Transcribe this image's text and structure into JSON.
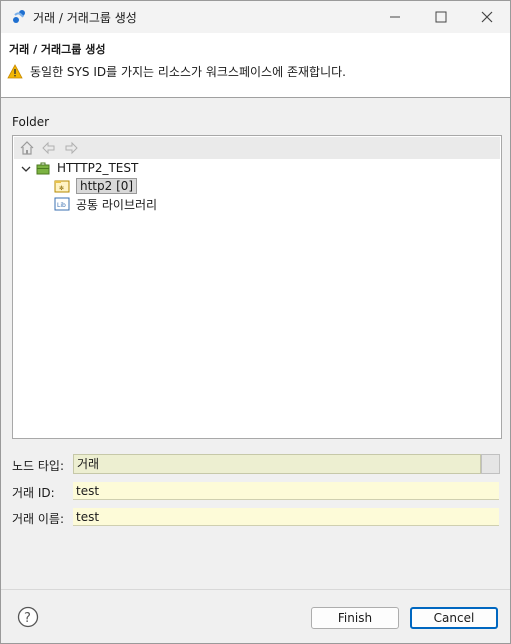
{
  "window": {
    "title": "거래 / 거래그룹 생성",
    "controls": {
      "minimize": "minimize-icon",
      "maximize": "maximize-icon",
      "close": "close-icon"
    }
  },
  "banner": {
    "heading": "거래 / 거래그룹 생성",
    "message": "동일한 SYS ID를 가지는 리소스가 워크스페이스에 존재합니다.",
    "message_icon": "warning-icon"
  },
  "folder": {
    "label": "Folder",
    "toolbar": [
      "home-icon",
      "back-arrow-icon",
      "forward-arrow-icon"
    ],
    "tree": {
      "root": {
        "label": "HTTTP2_TEST",
        "icon": "project-briefcase-icon",
        "expanded": true
      },
      "children": [
        {
          "label": "http2 [0]",
          "icon": "folder-icon",
          "selected": true
        },
        {
          "label": "공통 라이브러리",
          "icon": "library-icon",
          "selected": false
        }
      ]
    }
  },
  "form": {
    "node_type": {
      "label": "노드 타입:",
      "value": "거래"
    },
    "trade_id": {
      "label": "거래 ID:",
      "value": "test"
    },
    "trade_name": {
      "label": "거래 이름:",
      "value": "test"
    }
  },
  "buttons": {
    "finish": "Finish",
    "cancel": "Cancel"
  },
  "colors": {
    "accent": "#0067c0",
    "field_bg": "#fdfbd8",
    "warning": "#e8a400"
  }
}
